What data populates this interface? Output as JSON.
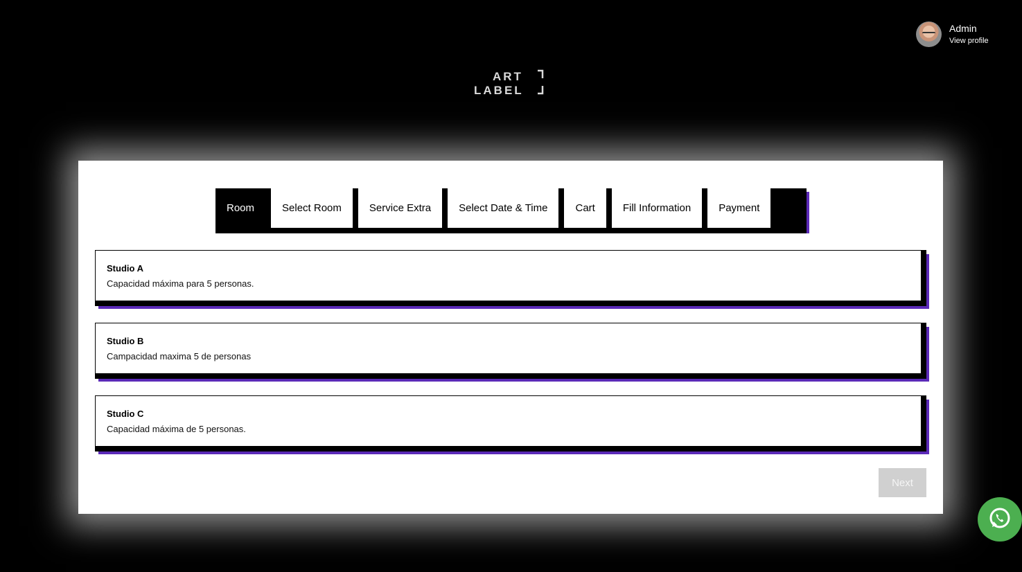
{
  "profile": {
    "name": "Admin",
    "link": "View profile"
  },
  "logo": {
    "line1": "ART",
    "line2": "LABEL"
  },
  "tabs": [
    {
      "label": "Room"
    },
    {
      "label": "Select Room"
    },
    {
      "label": "Service Extra"
    },
    {
      "label": "Select Date & Time"
    },
    {
      "label": "Cart"
    },
    {
      "label": "Fill Information"
    },
    {
      "label": "Payment"
    }
  ],
  "rooms": [
    {
      "title": "Studio A",
      "description": "Capacidad máxima para 5 personas."
    },
    {
      "title": "Studio B",
      "description": "Campacidad maxima 5 de personas"
    },
    {
      "title": "Studio C",
      "description": "Capacidad máxima de 5 personas."
    }
  ],
  "actions": {
    "next_label": "Next"
  },
  "icons": {
    "chat": "whatsapp-icon"
  },
  "colors": {
    "accent": "#5b2ab8",
    "whatsapp": "#4caf50",
    "disabled": "#d0d0d0"
  }
}
